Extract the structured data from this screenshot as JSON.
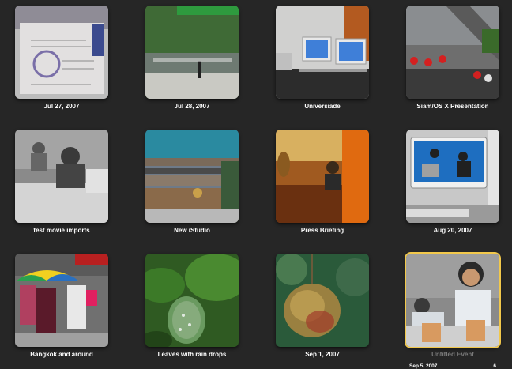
{
  "events": [
    {
      "title": "Jul 27, 2007"
    },
    {
      "title": "Jul 28, 2007"
    },
    {
      "title": "Universiade"
    },
    {
      "title": "Siam/OS X Presentation"
    },
    {
      "title": "test movie imports"
    },
    {
      "title": "New iStudio"
    },
    {
      "title": "Press Briefing"
    },
    {
      "title": "Aug 20, 2007"
    },
    {
      "title": "Bangkok and around"
    },
    {
      "title": "Leaves with rain drops"
    },
    {
      "title": "Sep 1, 2007"
    },
    {
      "title": "Untitled Event",
      "date": "Sep 5, 2007",
      "count": "6"
    }
  ],
  "colors": {
    "background": "#262626",
    "selection": "#f2c84b"
  }
}
